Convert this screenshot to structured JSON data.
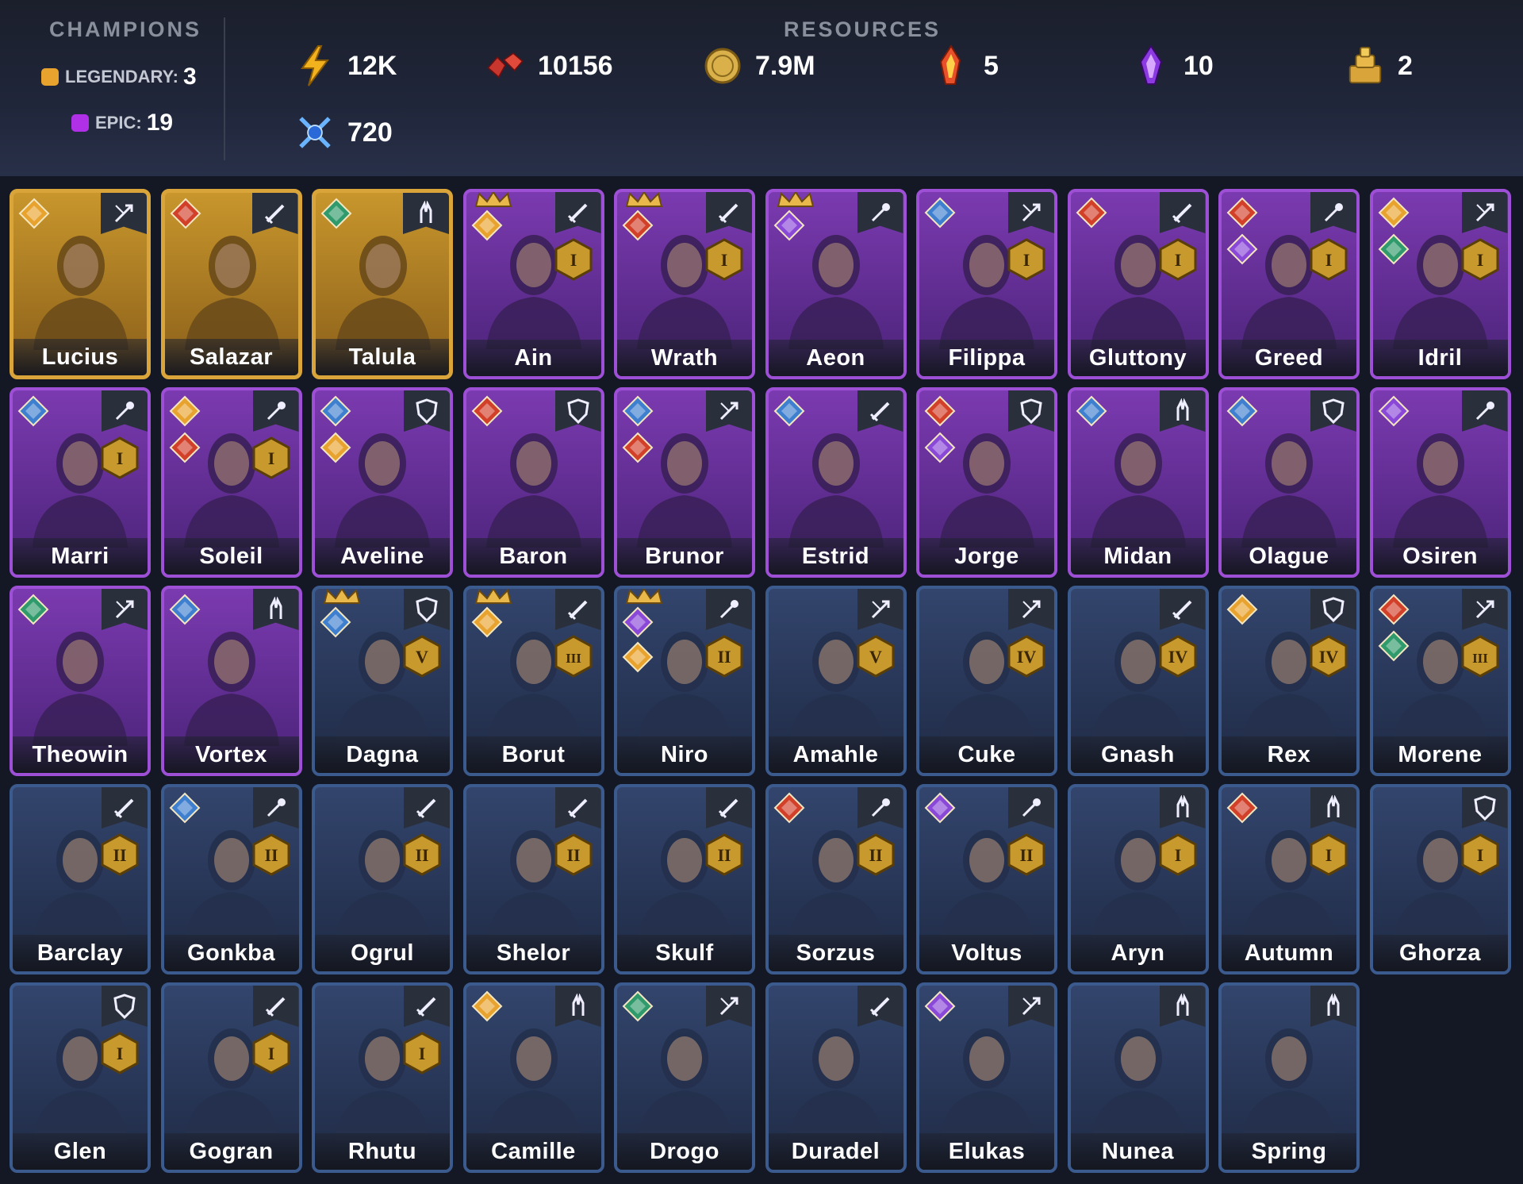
{
  "header": {
    "champions_title": "CHAMPIONS",
    "legendary_label": "LEGENDARY:",
    "legendary_count": "3",
    "epic_label": "EPIC:",
    "epic_count": "19",
    "resources_title": "RESOURCES",
    "resources": [
      {
        "icon": "energy-bolt-icon",
        "value": "12K"
      },
      {
        "icon": "ruby-gems-icon",
        "value": "10156"
      },
      {
        "icon": "gold-coin-icon",
        "value": "7.9M"
      },
      {
        "icon": "fire-shard-icon",
        "value": "5"
      },
      {
        "icon": "void-shard-icon",
        "value": "10"
      },
      {
        "icon": "gold-pile-icon",
        "value": "2"
      },
      {
        "icon": "arena-token-icon",
        "value": "720"
      }
    ]
  },
  "colors": {
    "legendary": "#d9a53a",
    "epic": "#9d4fd6",
    "rare": "#3b5a8e",
    "affinity_gold": "#e8a32e",
    "affinity_red": "#d2402a",
    "affinity_green": "#2f9a6b",
    "affinity_blue": "#3f7fd0",
    "affinity_purple": "#8a48d8"
  },
  "champions": [
    {
      "name": "Lucius",
      "rarity": "legendary",
      "role": "hunter-icon",
      "affinity": [
        "gold"
      ]
    },
    {
      "name": "Salazar",
      "rarity": "legendary",
      "role": "sword-icon",
      "affinity": [
        "red"
      ]
    },
    {
      "name": "Talula",
      "rarity": "legendary",
      "role": "support-icon",
      "affinity": [
        "green"
      ]
    },
    {
      "name": "Ain",
      "rarity": "epic",
      "role": "sword-icon",
      "affinity": [
        "gold"
      ],
      "ascension": "I",
      "crowned": true
    },
    {
      "name": "Wrath",
      "rarity": "epic",
      "role": "sword-icon",
      "affinity": [
        "red"
      ],
      "ascension": "I",
      "crowned": true
    },
    {
      "name": "Aeon",
      "rarity": "epic",
      "role": "mage-icon",
      "affinity": [
        "purple"
      ],
      "crowned": true
    },
    {
      "name": "Filippa",
      "rarity": "epic",
      "role": "hunter-icon",
      "affinity": [
        "blue"
      ],
      "ascension": "I"
    },
    {
      "name": "Gluttony",
      "rarity": "epic",
      "role": "sword-icon",
      "affinity": [
        "red"
      ],
      "ascension": "I"
    },
    {
      "name": "Greed",
      "rarity": "epic",
      "role": "mage-icon",
      "affinity": [
        "red",
        "purple"
      ],
      "ascension": "I"
    },
    {
      "name": "Idril",
      "rarity": "epic",
      "role": "hunter-icon",
      "affinity": [
        "gold",
        "green"
      ],
      "ascension": "I"
    },
    {
      "name": "Marri",
      "rarity": "epic",
      "role": "mage-icon",
      "affinity": [
        "blue"
      ],
      "ascension": "I"
    },
    {
      "name": "Soleil",
      "rarity": "epic",
      "role": "mage-icon",
      "affinity": [
        "gold",
        "red"
      ],
      "ascension": "I"
    },
    {
      "name": "Aveline",
      "rarity": "epic",
      "role": "shield-icon",
      "affinity": [
        "blue",
        "gold"
      ]
    },
    {
      "name": "Baron",
      "rarity": "epic",
      "role": "shield-icon",
      "affinity": [
        "red"
      ]
    },
    {
      "name": "Brunor",
      "rarity": "epic",
      "role": "hunter-icon",
      "affinity": [
        "blue",
        "red"
      ]
    },
    {
      "name": "Estrid",
      "rarity": "epic",
      "role": "sword-icon",
      "affinity": [
        "blue"
      ]
    },
    {
      "name": "Jorge",
      "rarity": "epic",
      "role": "shield-icon",
      "affinity": [
        "red",
        "purple"
      ]
    },
    {
      "name": "Midan",
      "rarity": "epic",
      "role": "support-icon",
      "affinity": [
        "blue"
      ]
    },
    {
      "name": "Olague",
      "rarity": "epic",
      "role": "shield-icon",
      "affinity": [
        "blue"
      ]
    },
    {
      "name": "Osiren",
      "rarity": "epic",
      "role": "mage-icon",
      "affinity": [
        "purple"
      ]
    },
    {
      "name": "Theowin",
      "rarity": "epic",
      "role": "hunter-icon",
      "affinity": [
        "green"
      ]
    },
    {
      "name": "Vortex",
      "rarity": "epic",
      "role": "support-icon",
      "affinity": [
        "blue"
      ]
    },
    {
      "name": "Dagna",
      "rarity": "rare",
      "role": "shield-icon",
      "affinity": [
        "blue"
      ],
      "ascension": "V",
      "crowned": true
    },
    {
      "name": "Borut",
      "rarity": "rare",
      "role": "sword-icon",
      "affinity": [
        "gold"
      ],
      "ascension": "III",
      "crowned": true
    },
    {
      "name": "Niro",
      "rarity": "rare",
      "role": "mage-icon",
      "affinity": [
        "purple",
        "gold"
      ],
      "ascension": "II",
      "crowned": true
    },
    {
      "name": "Amahle",
      "rarity": "rare",
      "role": "hunter-icon",
      "affinity": [],
      "ascension": "V"
    },
    {
      "name": "Cuke",
      "rarity": "rare",
      "role": "hunter-icon",
      "affinity": [],
      "ascension": "IV"
    },
    {
      "name": "Gnash",
      "rarity": "rare",
      "role": "sword-icon",
      "affinity": [],
      "ascension": "IV"
    },
    {
      "name": "Rex",
      "rarity": "rare",
      "role": "shield-icon",
      "affinity": [
        "gold"
      ],
      "ascension": "IV"
    },
    {
      "name": "Morene",
      "rarity": "rare",
      "role": "hunter-icon",
      "affinity": [
        "red",
        "green"
      ],
      "ascension": "III"
    },
    {
      "name": "Barclay",
      "rarity": "rare",
      "role": "sword-icon",
      "affinity": [],
      "ascension": "II"
    },
    {
      "name": "Gonkba",
      "rarity": "rare",
      "role": "mage-icon",
      "affinity": [
        "blue"
      ],
      "ascension": "II"
    },
    {
      "name": "Ogrul",
      "rarity": "rare",
      "role": "sword-icon",
      "affinity": [],
      "ascension": "II"
    },
    {
      "name": "Shelor",
      "rarity": "rare",
      "role": "sword-icon",
      "affinity": [],
      "ascension": "II"
    },
    {
      "name": "Skulf",
      "rarity": "rare",
      "role": "sword-icon",
      "affinity": [],
      "ascension": "II"
    },
    {
      "name": "Sorzus",
      "rarity": "rare",
      "role": "mage-icon",
      "affinity": [
        "red"
      ],
      "ascension": "II"
    },
    {
      "name": "Voltus",
      "rarity": "rare",
      "role": "mage-icon",
      "affinity": [
        "purple"
      ],
      "ascension": "II"
    },
    {
      "name": "Aryn",
      "rarity": "rare",
      "role": "support-icon",
      "affinity": [],
      "ascension": "I"
    },
    {
      "name": "Autumn",
      "rarity": "rare",
      "role": "support-icon",
      "affinity": [
        "red"
      ],
      "ascension": "I"
    },
    {
      "name": "Ghorza",
      "rarity": "rare",
      "role": "shield-icon",
      "affinity": [],
      "ascension": "I"
    },
    {
      "name": "Glen",
      "rarity": "rare",
      "role": "shield-icon",
      "affinity": [],
      "ascension": "I"
    },
    {
      "name": "Gogran",
      "rarity": "rare",
      "role": "sword-icon",
      "affinity": [],
      "ascension": "I"
    },
    {
      "name": "Rhutu",
      "rarity": "rare",
      "role": "sword-icon",
      "affinity": [],
      "ascension": "I"
    },
    {
      "name": "Camille",
      "rarity": "rare",
      "role": "support-icon",
      "affinity": [
        "gold"
      ]
    },
    {
      "name": "Drogo",
      "rarity": "rare",
      "role": "hunter-icon",
      "affinity": [
        "green"
      ]
    },
    {
      "name": "Duradel",
      "rarity": "rare",
      "role": "sword-icon",
      "affinity": []
    },
    {
      "name": "Elukas",
      "rarity": "rare",
      "role": "hunter-icon",
      "affinity": [
        "purple"
      ]
    },
    {
      "name": "Nunea",
      "rarity": "rare",
      "role": "support-icon",
      "affinity": []
    },
    {
      "name": "Spring",
      "rarity": "rare",
      "role": "support-icon",
      "affinity": []
    }
  ]
}
